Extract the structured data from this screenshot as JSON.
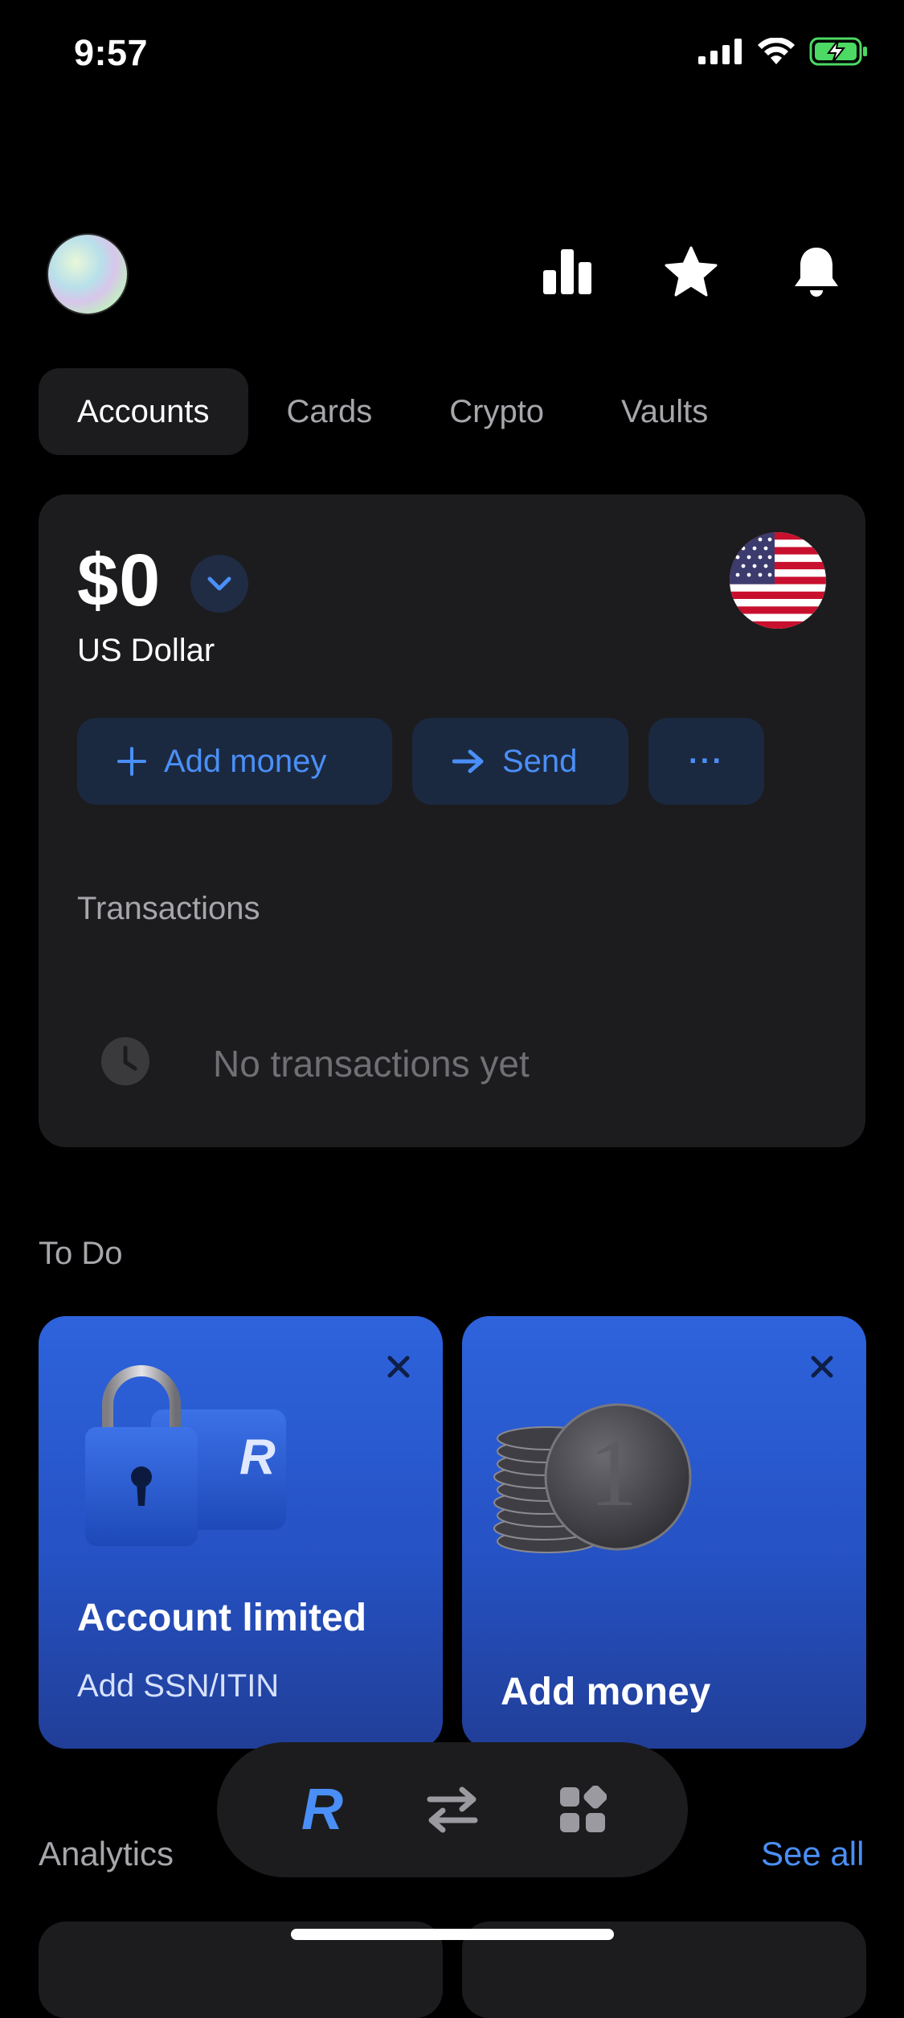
{
  "status": {
    "time": "9:57"
  },
  "header": {
    "avatar": "avatar",
    "icons": [
      "analytics-icon",
      "star-icon",
      "bell-icon"
    ]
  },
  "tabs": [
    {
      "label": "Accounts",
      "active": true
    },
    {
      "label": "Cards",
      "active": false
    },
    {
      "label": "Crypto",
      "active": false
    },
    {
      "label": "Vaults",
      "active": false
    }
  ],
  "account": {
    "balance": "$0",
    "currency": "US Dollar",
    "actions": {
      "add_money": "Add money",
      "send": "Send",
      "more": "···"
    },
    "transactions_title": "Transactions",
    "empty_text": "No transactions yet"
  },
  "todo": {
    "title": "To Do",
    "cards": [
      {
        "title": "Account limited",
        "subtitle": "Add SSN/ITIN",
        "brand_mark": "R"
      },
      {
        "title": "Add money",
        "coin_mark": "1"
      }
    ]
  },
  "analytics": {
    "title": "Analytics",
    "see_all": "See all"
  },
  "nav": {
    "items": [
      "home-icon",
      "transfer-icon",
      "hub-icon"
    ],
    "brand_letter": "R"
  },
  "colors": {
    "accent": "#4a8ff7",
    "card_bg": "#1c1c1e",
    "todo_blue": "#2e63dc"
  }
}
